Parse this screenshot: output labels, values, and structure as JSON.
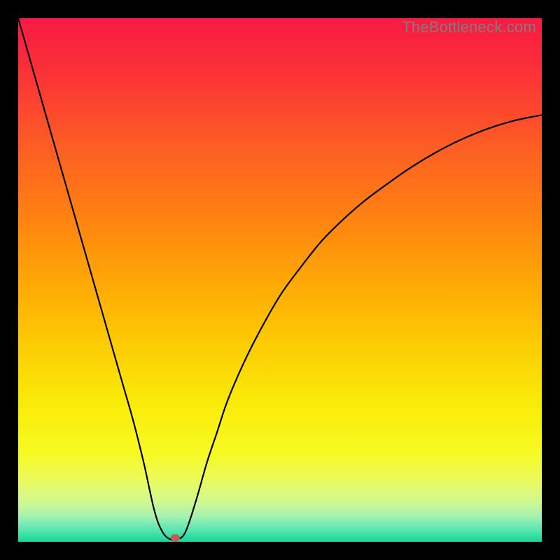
{
  "watermark": "TheBottleneck.com",
  "chart_data": {
    "type": "line",
    "title": "",
    "xlabel": "",
    "ylabel": "",
    "xlim": [
      0,
      100
    ],
    "ylim": [
      0,
      100
    ],
    "grid": false,
    "legend": false,
    "background_gradient_stops": [
      {
        "offset": 0.0,
        "color": "#f91944"
      },
      {
        "offset": 0.12,
        "color": "#fb3635"
      },
      {
        "offset": 0.25,
        "color": "#fd5f23"
      },
      {
        "offset": 0.38,
        "color": "#fe8212"
      },
      {
        "offset": 0.5,
        "color": "#ffa706"
      },
      {
        "offset": 0.62,
        "color": "#fdcb03"
      },
      {
        "offset": 0.74,
        "color": "#f9ec09"
      },
      {
        "offset": 0.83,
        "color": "#f7fa22"
      },
      {
        "offset": 0.88,
        "color": "#ebfb5a"
      },
      {
        "offset": 0.92,
        "color": "#d3f98d"
      },
      {
        "offset": 0.95,
        "color": "#a8f3af"
      },
      {
        "offset": 0.975,
        "color": "#60e6b4"
      },
      {
        "offset": 1.0,
        "color": "#15d798"
      }
    ],
    "series": [
      {
        "name": "bottleneck-curve",
        "stroke": "#000000",
        "x": [
          0,
          2,
          4,
          6,
          8,
          10,
          12,
          14,
          16,
          18,
          20,
          22,
          24,
          26,
          27.5,
          29,
          30.5,
          32,
          34,
          36,
          38,
          40,
          43,
          46,
          50,
          54,
          58,
          62,
          66,
          70,
          75,
          80,
          85,
          90,
          95,
          100
        ],
        "y": [
          100,
          93,
          86,
          79,
          72,
          65,
          58,
          51,
          44,
          37,
          30,
          23,
          15,
          6,
          2,
          0.5,
          0.5,
          2,
          8,
          15,
          21,
          27,
          34,
          40,
          47,
          52.5,
          57.5,
          61.5,
          65,
          68,
          71.5,
          74.5,
          77,
          79,
          80.5,
          81.5
        ]
      }
    ],
    "marker": {
      "name": "optimal-point",
      "x": 30,
      "y": 0,
      "rx": 6.5,
      "ry": 5.5,
      "fill": "#c45a52"
    }
  }
}
